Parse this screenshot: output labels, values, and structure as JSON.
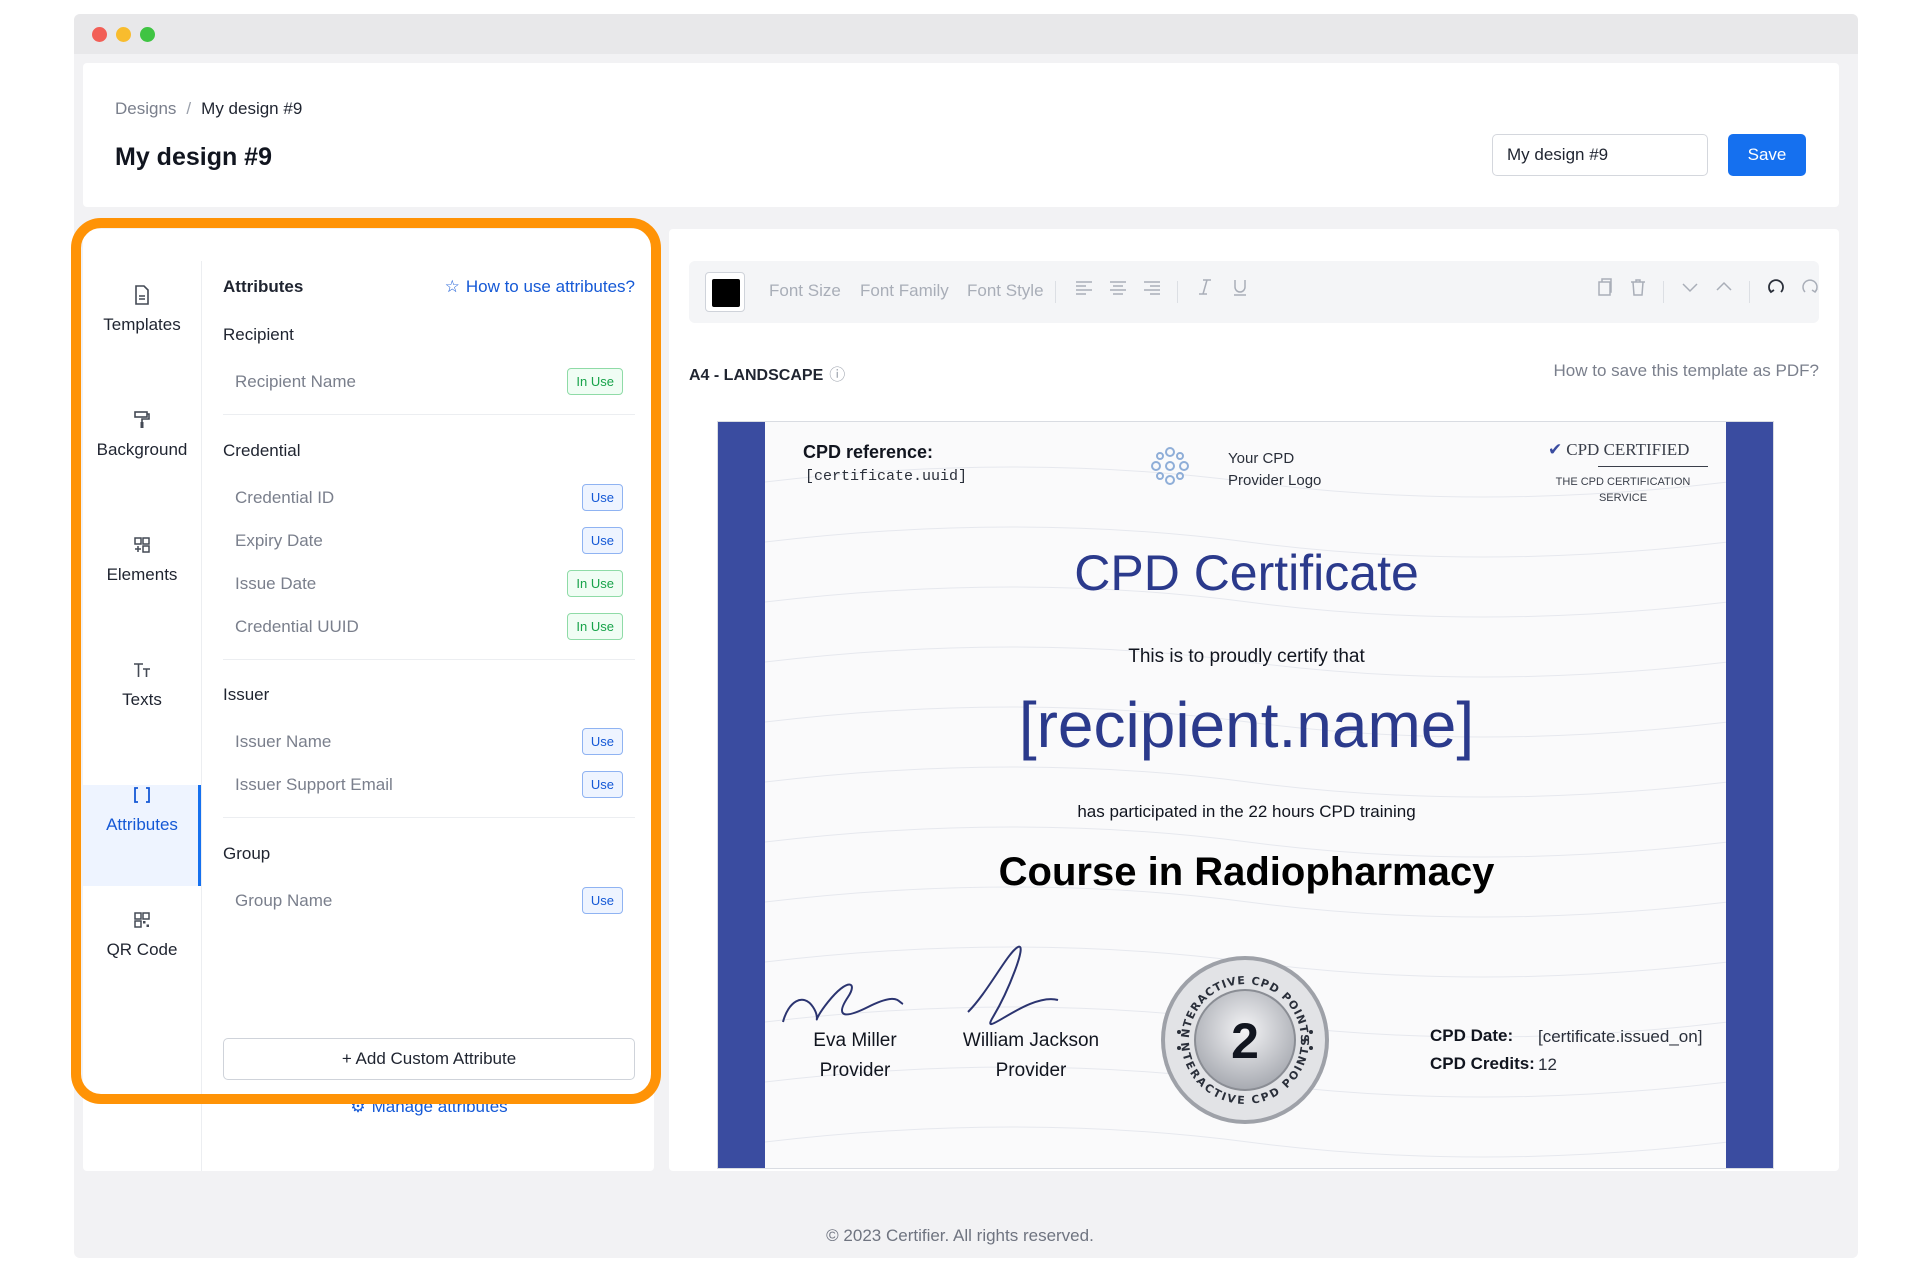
{
  "breadcrumb": {
    "root": "Designs",
    "separator": "/",
    "current": "My design #9"
  },
  "header": {
    "title": "My design #9",
    "name_input_value": "My design #9",
    "save_label": "Save"
  },
  "nav": {
    "items": [
      {
        "label": "Templates",
        "icon": "file-icon"
      },
      {
        "label": "Background",
        "icon": "paint-roller-icon"
      },
      {
        "label": "Elements",
        "icon": "elements-icon"
      },
      {
        "label": "Texts",
        "icon": "text-icon"
      },
      {
        "label": "Attributes",
        "icon": "brackets-icon"
      },
      {
        "label": "QR Code",
        "icon": "qr-code-icon"
      }
    ],
    "active": "Attributes"
  },
  "attributes": {
    "title": "Attributes",
    "help_link": "How to use attributes?",
    "groups": [
      {
        "title": "Recipient",
        "items": [
          {
            "label": "Recipient Name",
            "status": "In Use"
          }
        ]
      },
      {
        "title": "Credential",
        "items": [
          {
            "label": "Credential ID",
            "status": "Use"
          },
          {
            "label": "Expiry Date",
            "status": "Use"
          },
          {
            "label": "Issue Date",
            "status": "In Use"
          },
          {
            "label": "Credential UUID",
            "status": "In Use"
          }
        ]
      },
      {
        "title": "Issuer",
        "items": [
          {
            "label": "Issuer Name",
            "status": "Use"
          },
          {
            "label": "Issuer Support Email",
            "status": "Use"
          }
        ]
      },
      {
        "title": "Group",
        "items": [
          {
            "label": "Group Name",
            "status": "Use"
          }
        ]
      }
    ],
    "add_custom_label": "+ Add Custom Attribute",
    "manage_label": "Manage attributes"
  },
  "toolbar": {
    "color": "#000000",
    "font_size_label": "Font Size",
    "font_family_label": "Font Family",
    "font_style_label": "Font Style"
  },
  "canvas": {
    "paper_label": "A4 - LANDSCAPE",
    "pdf_help_link": "How to save this template as PDF?"
  },
  "certificate": {
    "cpd_reference_label": "CPD reference:",
    "cpd_reference_value": "[certificate.uuid]",
    "logo_text_line1": "Your CPD",
    "logo_text_line2": "Provider Logo",
    "certified_title": "CPD CERTIFIED",
    "certified_sub_line1": "THE CPD CERTIFICATION",
    "certified_sub_line2": "SERVICE",
    "title": "CPD Certificate",
    "subtitle": "This is to proudly certify that",
    "recipient": "[recipient.name]",
    "participated": "has participated in the 22 hours CPD training",
    "course": "Course in Radiopharmacy",
    "signers": [
      {
        "name": "Eva Miller",
        "role": "Provider"
      },
      {
        "name": "William Jackson",
        "role": "Provider"
      }
    ],
    "seal_number": "2",
    "seal_ring_text": "INTERACTIVE CPD POINTS",
    "cpd_date_label": "CPD Date:",
    "cpd_date_value": "[certificate.issued_on]",
    "cpd_credits_label": "CPD Credits:",
    "cpd_credits_value": "12",
    "band_color": "#3a4ca0",
    "title_color": "#2b3a8c"
  },
  "footer": {
    "copyright": "© 2023 Certifier. All rights reserved."
  }
}
